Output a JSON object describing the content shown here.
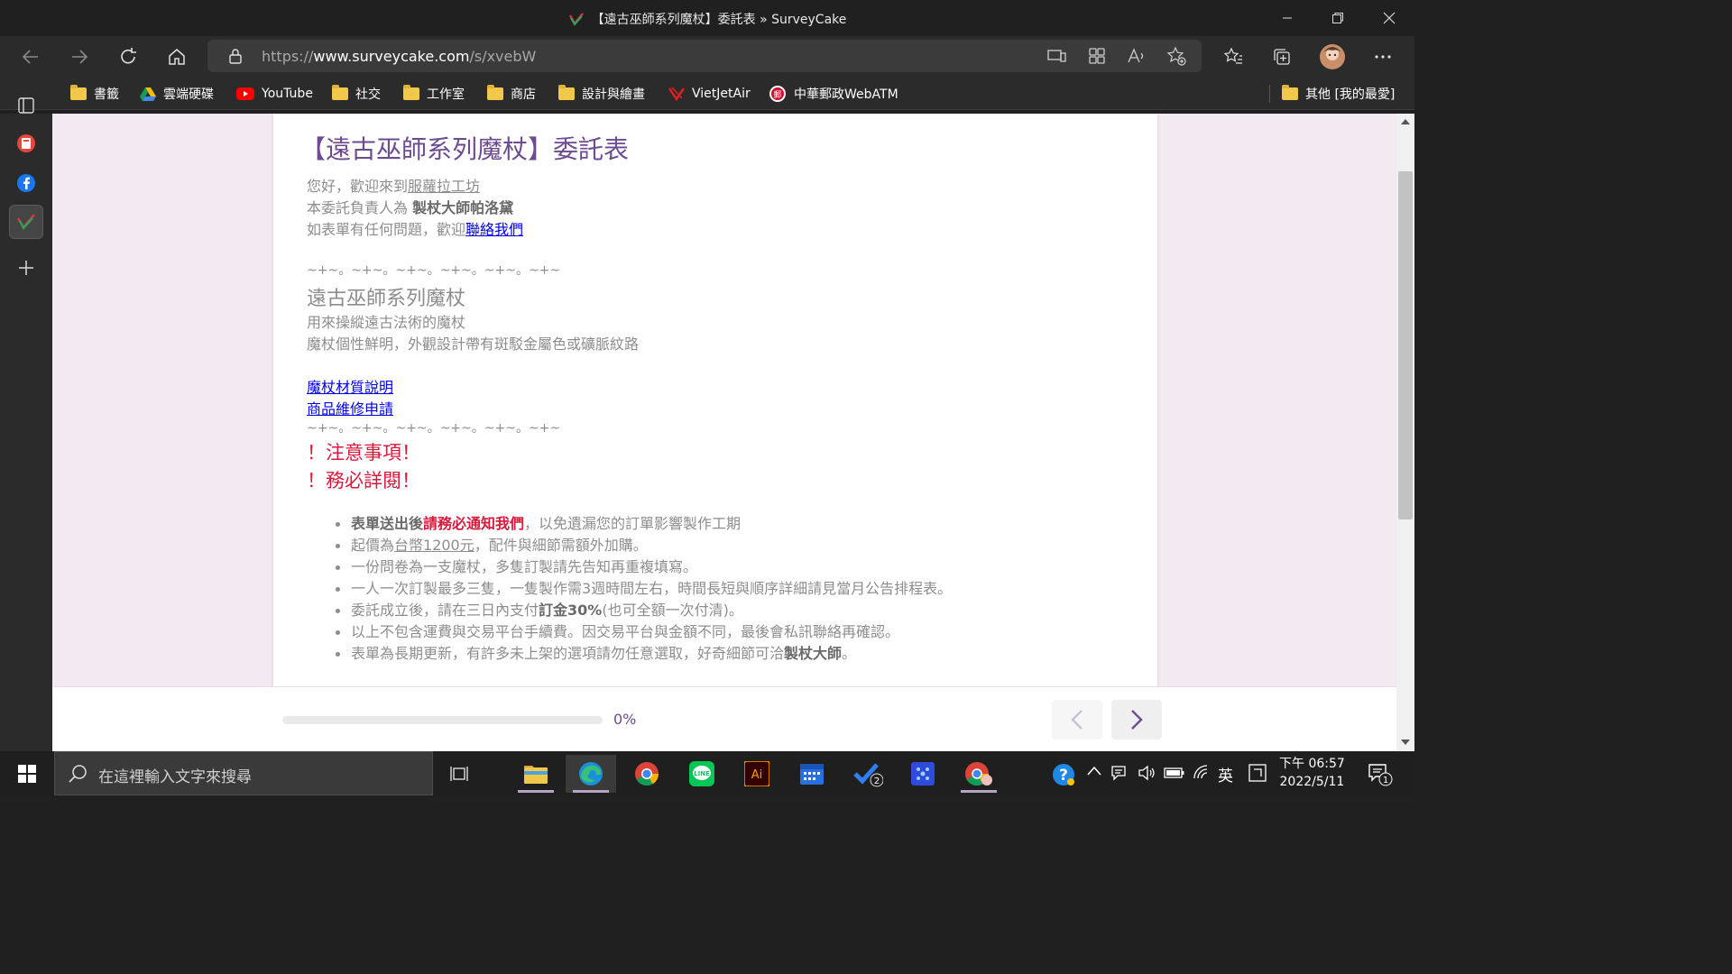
{
  "window": {
    "title": "【遠古巫師系列魔杖】委託表 » SurveyCake"
  },
  "address": {
    "scheme": "https://",
    "host": "www.surveycake.com",
    "path": "/s/xvebW"
  },
  "bookmarks": {
    "items": [
      {
        "label": "書籤",
        "icon": "folder-icon"
      },
      {
        "label": "雲端硬碟",
        "icon": "google-drive-icon"
      },
      {
        "label": "YouTube",
        "icon": "youtube-icon"
      },
      {
        "label": "社交",
        "icon": "folder-icon"
      },
      {
        "label": "工作室",
        "icon": "folder-icon"
      },
      {
        "label": "商店",
        "icon": "folder-icon"
      },
      {
        "label": "設計與繪畫",
        "icon": "folder-icon"
      },
      {
        "label": "VietJetAir",
        "icon": "vietjetair-icon"
      },
      {
        "label": "中華郵政WebATM",
        "icon": "post-office-icon"
      }
    ],
    "other": "其他 [我的最愛]"
  },
  "survey": {
    "title": "【遠古巫師系列魔杖】委託表",
    "greeting_prefix": "您好，歡迎來到",
    "workshop_name": "服蘿拉工坊",
    "owner_prefix": "本委託負責人為",
    "owner_name": "製杖大師帕洛黛",
    "contact_prefix": "如表單有任何問題，歡迎",
    "contact_link": "聯絡我們",
    "divider": "~+~。~+~。~+~。~+~。~+~。~+~",
    "series_title": "遠古巫師系列魔杖",
    "desc1": "用來操縱遠古法術的魔杖",
    "desc2": "魔杖個性鮮明，外觀設計帶有斑駁金屬色或礦脈紋路",
    "link_material": "魔杖材質說明",
    "link_repair": "商品維修申請",
    "notice1": "！注意事項！",
    "notice2": "！務必詳閱！",
    "notes": {
      "n1_bold": "表單送出後",
      "n1_red": "請務必通知我們",
      "n1_rest": "，以免遺漏您的訂單影響製作工期",
      "n2_prefix": "起價為",
      "n2_price": "台幣1200元",
      "n2_rest": "，配件與細節需額外加購。",
      "n3": "一份問卷為一支魔杖，多隻訂製請先告知再重複填寫。",
      "n4": "一人一次訂製最多三隻，一隻製作需3週時間左右，時間長短與順序詳細請見當月公告排程表。",
      "n5_prefix": "委託成立後，請在三日內支付",
      "n5_bold": "訂金30%",
      "n5_rest": "(也可全額一次付清)。",
      "n6": "以上不包含運費與交易平台手續費。因交易平台與金額不同，最後會私訊聯絡再確認。",
      "n7_prefix": "表單為長期更新，有許多未上架的選項請勿任意選取，好奇細節可洽",
      "n7_bold": "製杖大師",
      "n7_end": "。"
    }
  },
  "footer": {
    "progress_text": "0%",
    "progress_value": 0
  },
  "taskbar": {
    "search_placeholder": "在這裡輸入文字來搜尋",
    "ime": "英",
    "time": "下午 06:57",
    "date": "2022/5/11",
    "notification_count": "1",
    "todo_badge": "2"
  },
  "colors": {
    "accent": "#6e4a90",
    "notice_red": "#d81b3c",
    "page_bg": "#f2e9f1"
  }
}
